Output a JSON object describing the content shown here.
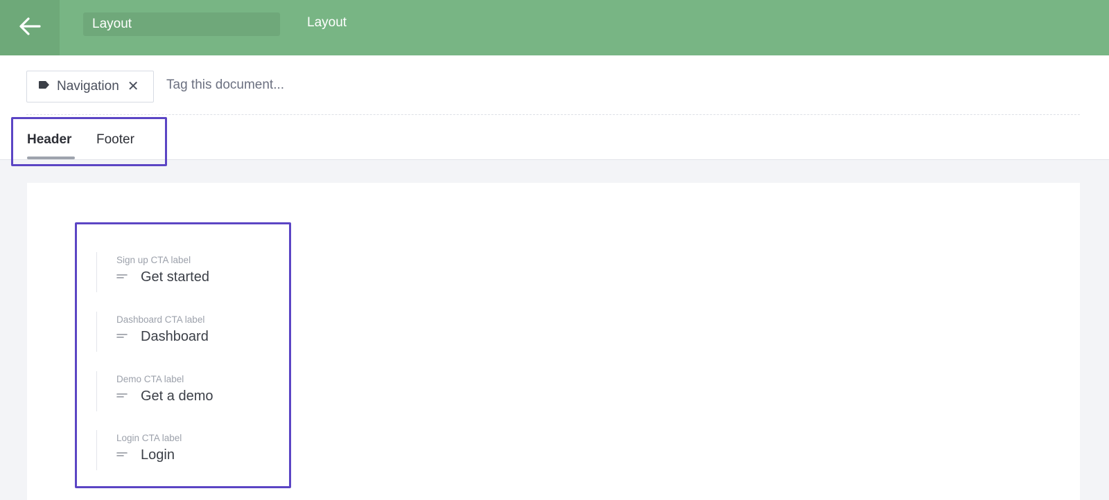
{
  "header": {
    "back_icon": "arrow-left-icon",
    "title_input_value": "Layout",
    "title_text": "Layout",
    "bar_color": "#78b584"
  },
  "tags": {
    "items": [
      {
        "label": "Navigation",
        "icon": "tag-icon",
        "remove_icon": "close-icon"
      }
    ],
    "input_placeholder": "Tag this document..."
  },
  "tabs": [
    {
      "label": "Header",
      "active": true
    },
    {
      "label": "Footer",
      "active": false
    }
  ],
  "fields": [
    {
      "label": "Sign up CTA label",
      "value": "Get started",
      "icon": "text-field-icon"
    },
    {
      "label": "Dashboard CTA label",
      "value": "Dashboard",
      "icon": "text-field-icon"
    },
    {
      "label": "Demo CTA label",
      "value": "Get a demo",
      "icon": "text-field-icon"
    },
    {
      "label": "Login CTA label",
      "value": "Login",
      "icon": "text-field-icon"
    }
  ],
  "colors": {
    "annotation": "#5b45c4",
    "tab_underline": "#9ea3ad"
  }
}
